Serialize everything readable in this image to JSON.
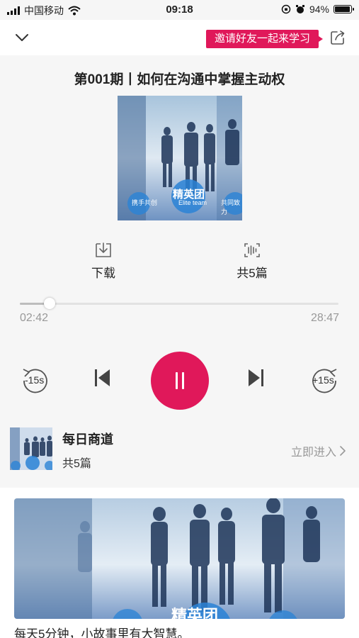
{
  "status_bar": {
    "carrier": "中国移动",
    "time": "09:18",
    "battery": "94%",
    "battery_level": 0.94
  },
  "nav": {
    "invite_label": "邀请好友一起来学习"
  },
  "episode": {
    "title": "第001期丨如何在沟通中掌握主动权",
    "cover_caption": "精英团",
    "cover_caption_en": "Elite team",
    "cover_left_badge": "携手共创",
    "cover_right_badge": "共同致力"
  },
  "actions": {
    "download_label": "下载",
    "episodes_label": "共5篇"
  },
  "player": {
    "current_time": "02:42",
    "total_time": "28:47",
    "progress": 0.094,
    "rewind_label": "-15s",
    "forward_label": "+15s"
  },
  "album": {
    "name": "每日商道",
    "count": "共5篇",
    "enter_label": "立即进入"
  },
  "banner": {
    "caption": "精英团",
    "description": "每天5分钟，小故事里有大智慧。"
  },
  "colors": {
    "accent": "#e0185a",
    "muted": "#999999"
  }
}
